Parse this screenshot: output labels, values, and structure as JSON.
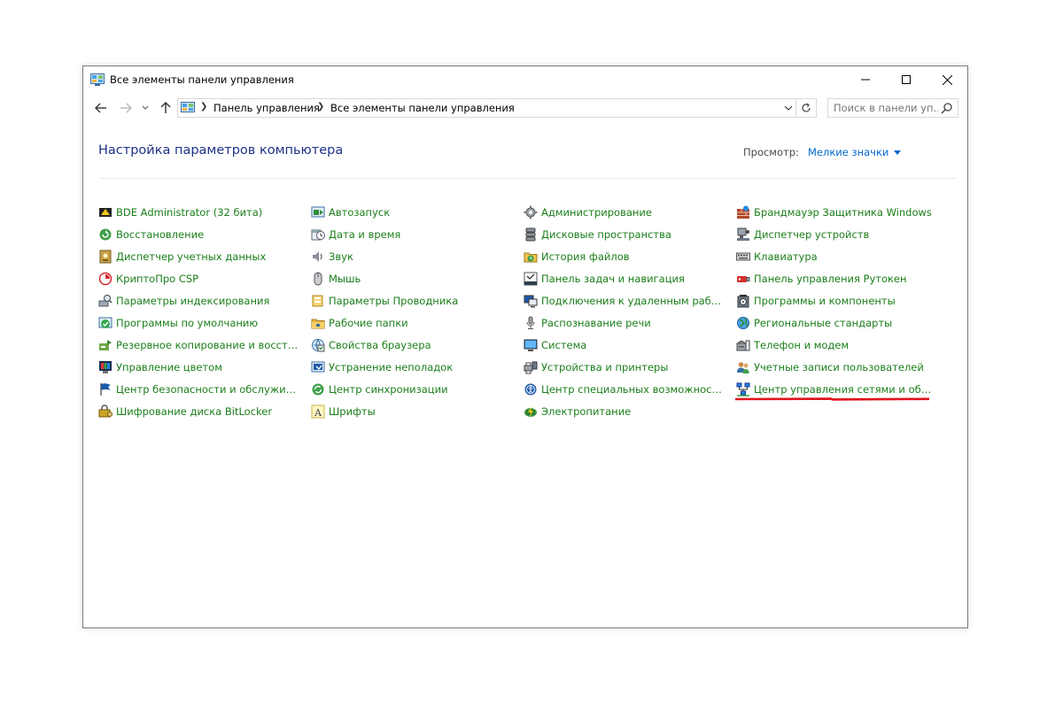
{
  "window": {
    "title": "Все элементы панели управления"
  },
  "address": {
    "crumbs": [
      "Панель управления",
      "Все элементы панели управления"
    ]
  },
  "search": {
    "placeholder": "Поиск в панели уп..."
  },
  "header": {
    "title": "Настройка параметров компьютера",
    "view_label": "Просмотр:",
    "view_value": "Мелкие значки"
  },
  "colors": {
    "link_green": "#1a7e1a",
    "title_blue": "#1e3287",
    "dropdown_blue": "#0066cc",
    "highlight_red": "#e0141e"
  },
  "columns": [
    {
      "items": [
        {
          "label": "BDE Administrator (32 бита)",
          "icon": "bde-icon"
        },
        {
          "label": "Восстановление",
          "icon": "recovery-icon"
        },
        {
          "label": "Диспетчер учетных данных",
          "icon": "credential-manager-icon"
        },
        {
          "label": "КриптоПро CSP",
          "icon": "cryptopro-icon"
        },
        {
          "label": "Параметры индексирования",
          "icon": "indexing-icon"
        },
        {
          "label": "Программы по умолчанию",
          "icon": "default-programs-icon"
        },
        {
          "label": "Резервное копирование и восстан...",
          "icon": "backup-icon"
        },
        {
          "label": "Управление цветом",
          "icon": "color-management-icon"
        },
        {
          "label": "Центр безопасности и обслуживан...",
          "icon": "flag-icon"
        },
        {
          "label": "Шифрование диска BitLocker",
          "icon": "bitlocker-icon"
        }
      ]
    },
    {
      "items": [
        {
          "label": "Автозапуск",
          "icon": "autoplay-icon"
        },
        {
          "label": "Дата и время",
          "icon": "date-time-icon"
        },
        {
          "label": "Звук",
          "icon": "sound-icon"
        },
        {
          "label": "Мышь",
          "icon": "mouse-icon"
        },
        {
          "label": "Параметры Проводника",
          "icon": "explorer-options-icon"
        },
        {
          "label": "Рабочие папки",
          "icon": "work-folders-icon"
        },
        {
          "label": "Свойства браузера",
          "icon": "internet-options-icon"
        },
        {
          "label": "Устранение неполадок",
          "icon": "troubleshooting-icon"
        },
        {
          "label": "Центр синхронизации",
          "icon": "sync-center-icon"
        },
        {
          "label": "Шрифты",
          "icon": "fonts-icon"
        }
      ]
    },
    {
      "items": [
        {
          "label": "Администрирование",
          "icon": "admin-tools-icon"
        },
        {
          "label": "Дисковые пространства",
          "icon": "storage-spaces-icon"
        },
        {
          "label": "История файлов",
          "icon": "file-history-icon"
        },
        {
          "label": "Панель задач и навигация",
          "icon": "taskbar-icon"
        },
        {
          "label": "Подключения к удаленным рабоч...",
          "icon": "remote-desktop-icon"
        },
        {
          "label": "Распознавание речи",
          "icon": "microphone-icon"
        },
        {
          "label": "Система",
          "icon": "system-icon"
        },
        {
          "label": "Устройства и принтеры",
          "icon": "printer-icon"
        },
        {
          "label": "Центр специальных возможностей",
          "icon": "accessibility-icon"
        },
        {
          "label": "Электропитание",
          "icon": "power-icon"
        }
      ]
    },
    {
      "items": [
        {
          "label": "Брандмауэр Защитника Windows",
          "icon": "firewall-icon"
        },
        {
          "label": "Диспетчер устройств",
          "icon": "device-manager-icon"
        },
        {
          "label": "Клавиатура",
          "icon": "keyboard-icon"
        },
        {
          "label": "Панель управления Рутокен",
          "icon": "rutoken-icon"
        },
        {
          "label": "Программы и компоненты",
          "icon": "programs-features-icon"
        },
        {
          "label": "Региональные стандарты",
          "icon": "region-icon"
        },
        {
          "label": "Телефон и модем",
          "icon": "phone-modem-icon"
        },
        {
          "label": "Учетные записи пользователей",
          "icon": "user-accounts-icon"
        },
        {
          "label": "Центр управления сетями и общи...",
          "icon": "network-icon"
        }
      ]
    }
  ]
}
